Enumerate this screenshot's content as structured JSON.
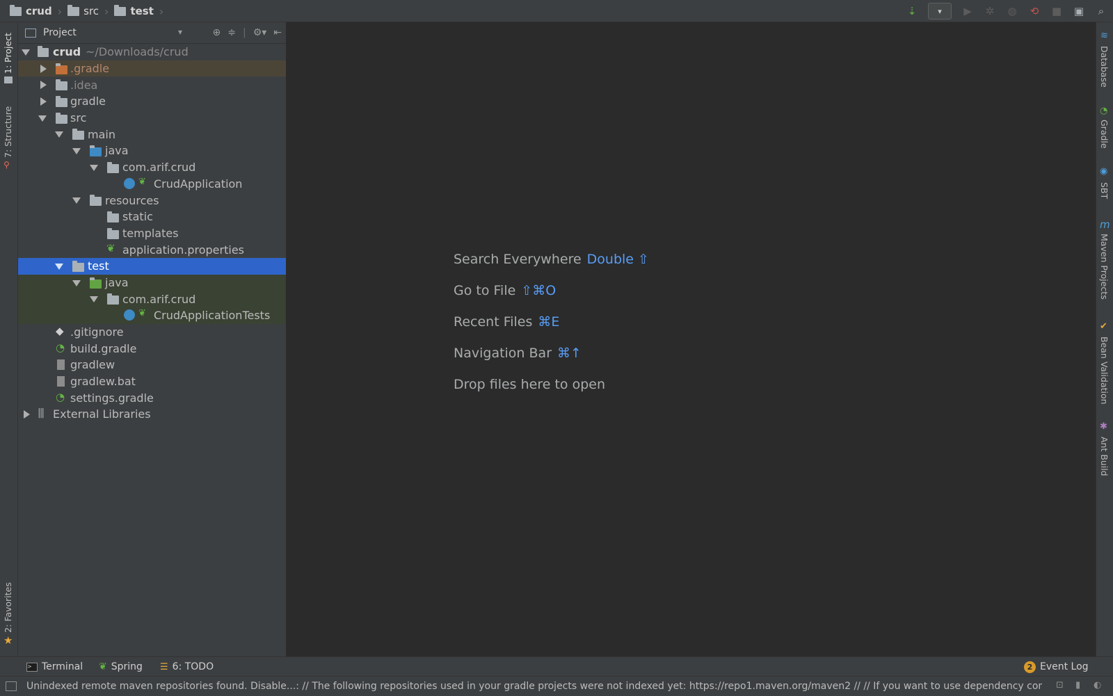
{
  "breadcrumbs": [
    "crud",
    "src",
    "test"
  ],
  "project_panel": {
    "title": "Project",
    "tree": [
      {
        "name": "crud",
        "path": "~/Downloads/crud"
      },
      {
        "name": ".gradle"
      },
      {
        "name": ".idea"
      },
      {
        "name": "gradle"
      },
      {
        "name": "src"
      },
      {
        "name": "main"
      },
      {
        "name": "java"
      },
      {
        "name": "com.arif.crud"
      },
      {
        "name": "CrudApplication"
      },
      {
        "name": "resources"
      },
      {
        "name": "static"
      },
      {
        "name": "templates"
      },
      {
        "name": "application.properties"
      },
      {
        "name": "test"
      },
      {
        "name": "java"
      },
      {
        "name": "com.arif.crud"
      },
      {
        "name": "CrudApplicationTests"
      },
      {
        "name": ".gitignore"
      },
      {
        "name": "build.gradle"
      },
      {
        "name": "gradlew"
      },
      {
        "name": "gradlew.bat"
      },
      {
        "name": "settings.gradle"
      },
      {
        "name": "External Libraries"
      }
    ]
  },
  "left_tabs": {
    "project": "1: Project",
    "structure": "7: Structure",
    "favorites": "2: Favorites"
  },
  "right_tabs": {
    "database": "Database",
    "gradle": "Gradle",
    "sbt": "SBT",
    "maven": "Maven Projects",
    "bean": "Bean Validation",
    "ant": "Ant Build"
  },
  "editor_hints": [
    {
      "label": "Search Everywhere",
      "key": "Double ⇧"
    },
    {
      "label": "Go to File",
      "key": "⇧⌘O"
    },
    {
      "label": "Recent Files",
      "key": "⌘E"
    },
    {
      "label": "Navigation Bar",
      "key": "⌘↑"
    },
    {
      "label": "Drop files here to open",
      "key": ""
    }
  ],
  "bottom_tabs": {
    "terminal": "Terminal",
    "spring": "Spring",
    "todo": "6: TODO",
    "event_log": "Event Log",
    "event_count": "2"
  },
  "status_message": "Unindexed remote maven repositories found. Disable...: // The following repositories used in your gradle projects were not indexed yet: https://repo1.maven.org/maven2 // // If you want to use dependency comp... (moments ago)",
  "colors": {
    "selection": "#2f65ca",
    "accent_key": "#589df6",
    "panel_bg": "#3c3f41",
    "editor_bg": "#2b2b2b"
  }
}
